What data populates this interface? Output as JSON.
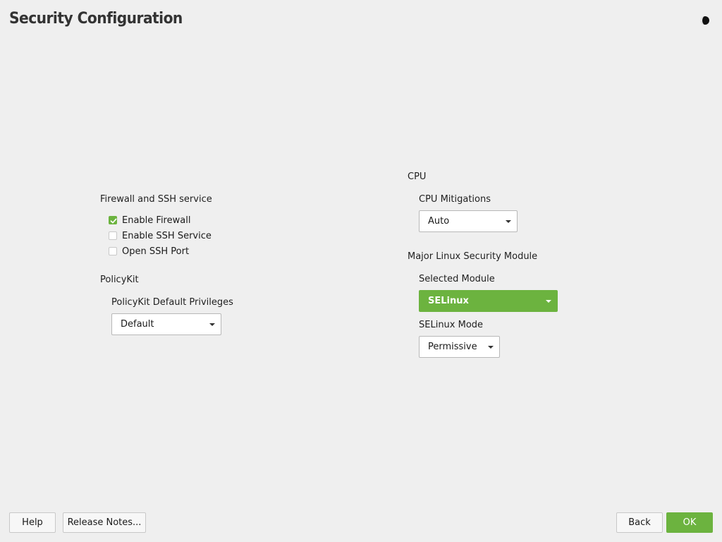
{
  "window": {
    "title": "Security Configuration"
  },
  "left": {
    "firewall_section": {
      "label": "Firewall and SSH service",
      "enable_firewall": {
        "label": "Enable Firewall",
        "checked": true
      },
      "enable_ssh": {
        "label": "Enable SSH Service",
        "checked": false
      },
      "open_ssh_port": {
        "label": "Open SSH Port",
        "checked": false
      }
    },
    "policykit_section": {
      "label": "PolicyKit",
      "privileges_label": "PolicyKit Default Privileges",
      "privileges_value": "Default"
    }
  },
  "right": {
    "cpu_section": {
      "label": "CPU",
      "mitigations_label": "CPU Mitigations",
      "mitigations_value": "Auto"
    },
    "lsm_section": {
      "label": "Major Linux Security Module",
      "module_label": "Selected Module",
      "module_value": "SELinux",
      "selinux_mode_label": "SELinux Mode",
      "selinux_mode_value": "Permissive"
    }
  },
  "footer": {
    "help": "Help",
    "release_notes": "Release Notes...",
    "back": "Back",
    "ok": "OK"
  },
  "icons": {
    "theme": "contrast-half-moon-icon",
    "check": "checkmark-icon",
    "dropdown": "dropdown-arrow-icon"
  },
  "colors": {
    "accent": "#6cb33f",
    "background": "#efefef"
  }
}
